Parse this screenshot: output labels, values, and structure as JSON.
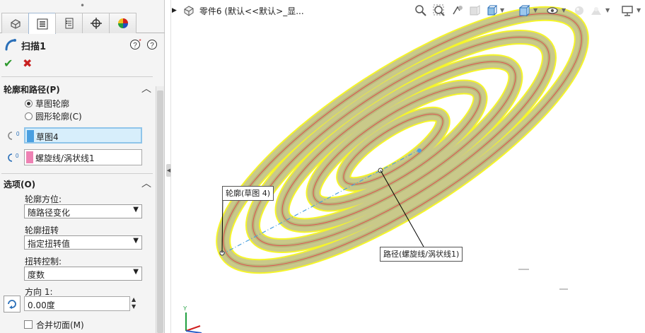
{
  "window": {
    "breadcrumb": "零件6 (默认<<默认>_显..."
  },
  "property_manager": {
    "grip": "•",
    "tabs": [
      {
        "name": "feature-manager",
        "icon": "feature-tree-icon"
      },
      {
        "name": "property-manager",
        "icon": "property-list-icon"
      },
      {
        "name": "configuration-manager",
        "icon": "configuration-icon"
      },
      {
        "name": "dimxpert-manager",
        "icon": "crosshair-icon"
      },
      {
        "name": "display-manager",
        "icon": "appearance-icon"
      }
    ],
    "title": "扫描1",
    "help_icons": [
      "help-detail-icon",
      "help-icon"
    ],
    "ok": "✔",
    "cancel": "✖",
    "profile_section": {
      "title": "轮廓和路径(P)",
      "options": [
        {
          "label": "草图轮廓",
          "selected": true
        },
        {
          "label": "圆形轮廓(C)",
          "selected": false
        }
      ],
      "profile_value": "草图4",
      "path_value": "螺旋线/涡状线1",
      "profile_color": "#4a9fe0",
      "path_color": "#ee82b4"
    },
    "options_section": {
      "title": "选项(O)",
      "orientation_label": "轮廓方位:",
      "orientation_value": "随路径变化",
      "twist_label": "轮廓扭转",
      "twist_value": "指定扭转值",
      "twist_control_label": "扭转控制:",
      "twist_control_value": "度数",
      "direction_label": "方向 1:",
      "direction_value": "0.00度",
      "merge_label": "合并切面(M)",
      "merge_checked": false
    }
  },
  "graphics": {
    "callout_profile": "轮廓(草图 4)",
    "callout_path": "路径(螺旋线/涡状线1)",
    "triad_label": "Y",
    "model_fill": "#c9c98a",
    "model_edge": "#f5f52a",
    "path_color": "#e05050"
  },
  "heads_up_toolbar": [
    "zoom-to-fit-icon",
    "zoom-to-area-icon",
    "previous-view-icon",
    "section-view-icon",
    "view-orientation-icon",
    "display-style-icon",
    "hide-show-icon",
    "edit-appearance-icon",
    "apply-scene-icon",
    "view-settings-icon"
  ]
}
